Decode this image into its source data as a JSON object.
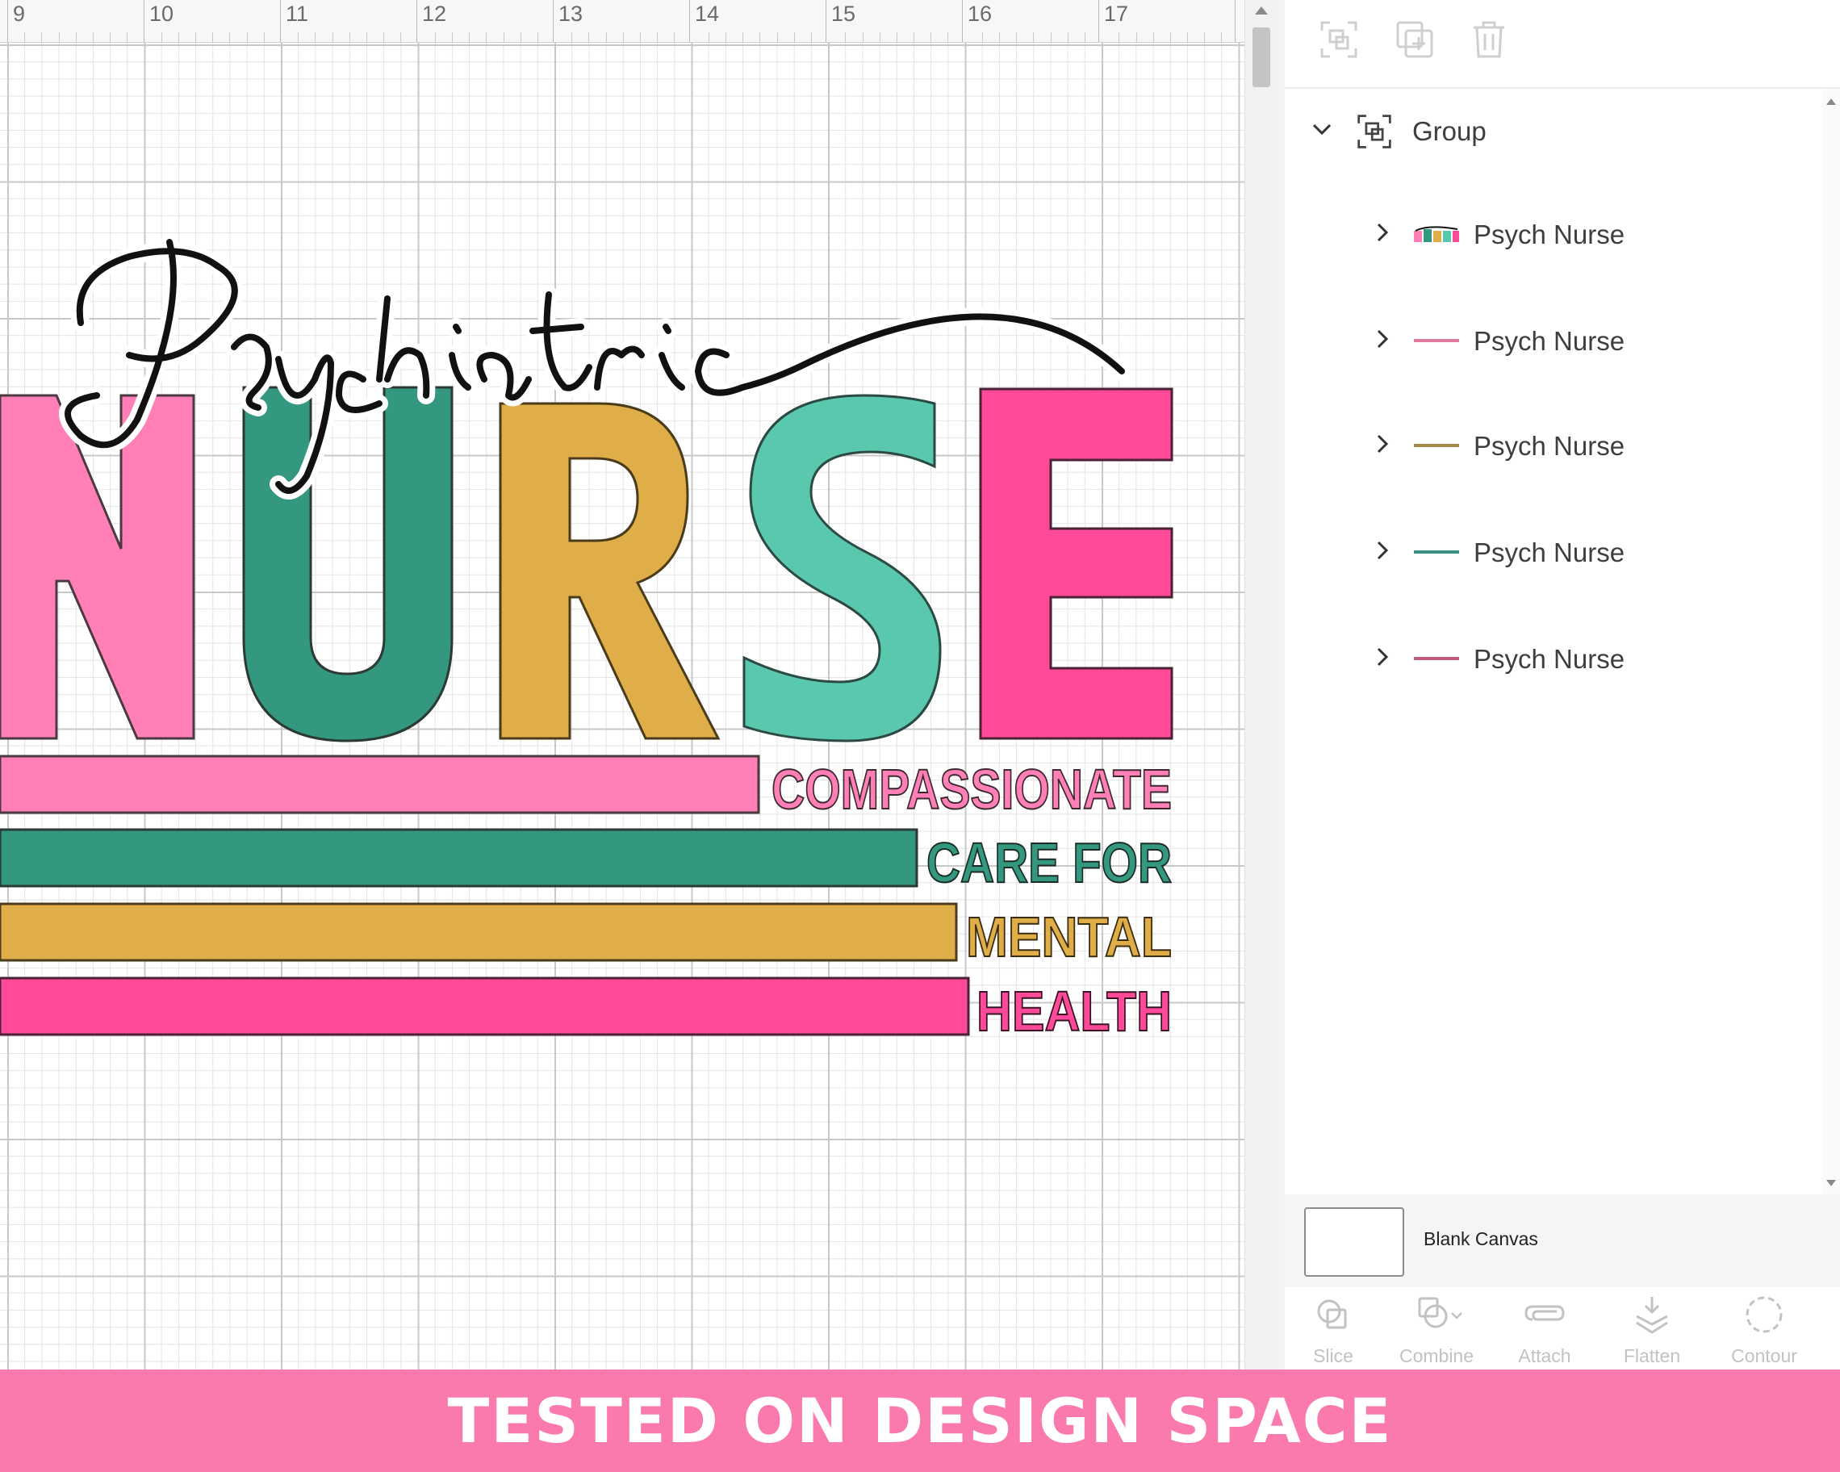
{
  "ruler": {
    "marks": [
      "9",
      "10",
      "11",
      "12",
      "13",
      "14",
      "15",
      "16",
      "17"
    ]
  },
  "artwork": {
    "script_word": "Psychiatric",
    "big_word_letters": [
      "N",
      "U",
      "R",
      "S",
      "E"
    ],
    "lines": [
      "COMPASSIONATE",
      "CARE FOR",
      "MENTAL",
      "HEALTH"
    ]
  },
  "colors": {
    "pink": "#ff7fb6",
    "teal": "#33987f",
    "mustard": "#e0ae48",
    "mint": "#5ac8ae",
    "hotpink": "#ff4a9a",
    "banner": "#fb7aae"
  },
  "toolbar": {
    "icons": [
      "group-icon",
      "duplicate-icon",
      "delete-icon"
    ]
  },
  "layers": {
    "group_label": "Group",
    "items": [
      {
        "label": "Psych Nurse",
        "swatch": "multicolor"
      },
      {
        "label": "Psych Nurse",
        "swatch": "#e07aa0"
      },
      {
        "label": "Psych Nurse",
        "swatch": "#a48a4a"
      },
      {
        "label": "Psych Nurse",
        "swatch": "#3a8f80"
      },
      {
        "label": "Psych Nurse",
        "swatch": "#c05a7a"
      }
    ]
  },
  "canvas": {
    "label": "Blank Canvas"
  },
  "tools": [
    {
      "label": "Slice",
      "icon": "slice-icon"
    },
    {
      "label": "Combine",
      "icon": "combine-icon"
    },
    {
      "label": "Attach",
      "icon": "attach-icon"
    },
    {
      "label": "Flatten",
      "icon": "flatten-icon"
    },
    {
      "label": "Contour",
      "icon": "contour-icon"
    }
  ],
  "banner": {
    "text": "TESTED ON DESIGN SPACE"
  }
}
